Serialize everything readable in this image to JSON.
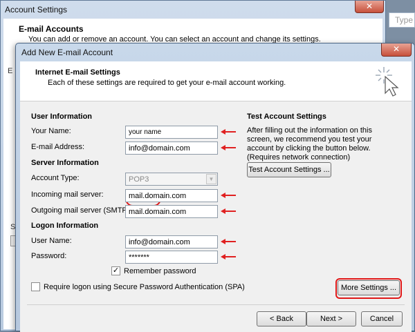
{
  "background_window": {
    "title": "Account Settings",
    "close_glyph": "✕",
    "heading": "E-mail Accounts",
    "subtext": "You can add or remove an account. You can select an account and change its settings.",
    "edge_text_1": "E",
    "edge_text_2": "S"
  },
  "type_box": {
    "placeholder": "Type"
  },
  "dialog": {
    "title": "Add New E-mail Account",
    "close_glyph": "✕",
    "header": {
      "title": "Internet E-mail Settings",
      "description": "Each of these settings are required to get your e-mail account working."
    },
    "user_info": {
      "section_title": "User Information",
      "your_name_label": "Your Name:",
      "your_name_value": "your name",
      "email_label": "E-mail Address:",
      "email_value": "info@domain.com"
    },
    "server_info": {
      "section_title": "Server Information",
      "account_type_label": "Account Type:",
      "account_type_value": "POP3",
      "incoming_label": "Incoming mail server:",
      "incoming_value": "mail.domain.com",
      "outgoing_label": "Outgoing mail server (SMTP):",
      "outgoing_value": "mail.domain.com"
    },
    "logon_info": {
      "section_title": "Logon Information",
      "user_name_label": "User Name:",
      "user_name_value": "info@domain.com",
      "password_label": "Password:",
      "password_value": "*******",
      "remember_label": "Remember password",
      "remember_checked": "✓"
    },
    "spa_label": "Require logon using Secure Password Authentication (SPA)",
    "test": {
      "section_title": "Test Account Settings",
      "description": "After filling out the information on this screen, we recommend you test your account by clicking the button below. (Requires network connection)",
      "button_label": "Test Account Settings ..."
    },
    "more_settings_label": "More Settings ...",
    "back_label": "< Back",
    "next_label": "Next >",
    "cancel_label": "Cancel"
  },
  "colors": {
    "annotation_red": "#e02020",
    "window_frame": "#b9cbe0"
  }
}
